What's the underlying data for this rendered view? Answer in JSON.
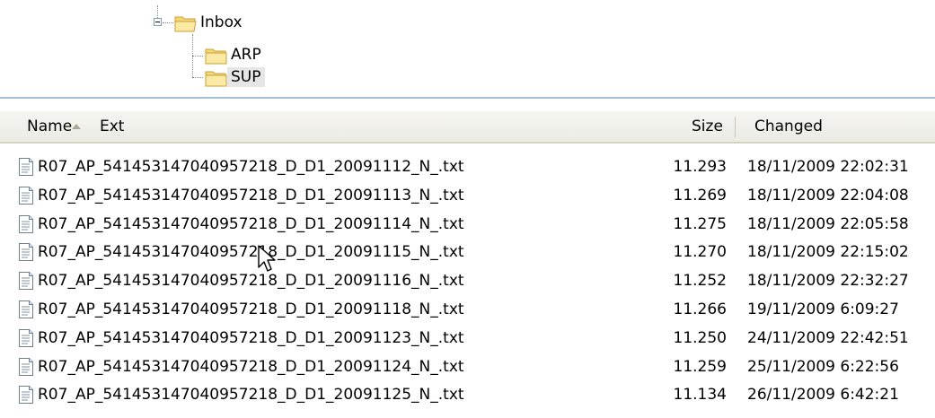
{
  "tree": {
    "items": [
      {
        "label": "Inbox",
        "icon": "open-folder-icon"
      },
      {
        "label": "ARP",
        "icon": "folder-icon"
      },
      {
        "label": "SUP",
        "icon": "folder-icon",
        "selected": true
      }
    ]
  },
  "list": {
    "columns": {
      "name": "Name",
      "ext": "Ext",
      "size": "Size",
      "changed": "Changed"
    },
    "sort": {
      "column": "name",
      "direction": "ascending"
    },
    "rows": [
      {
        "name": "R07_AP_541453147040957218_D_D1_20091112_N_.txt",
        "size": "11.293",
        "changed": "18/11/2009 22:02:31"
      },
      {
        "name": "R07_AP_541453147040957218_D_D1_20091113_N_.txt",
        "size": "11.269",
        "changed": "18/11/2009 22:04:08"
      },
      {
        "name": "R07_AP_541453147040957218_D_D1_20091114_N_.txt",
        "size": "11.275",
        "changed": "18/11/2009 22:05:58"
      },
      {
        "name": "R07_AP_541453147040957218_D_D1_20091115_N_.txt",
        "size": "11.270",
        "changed": "18/11/2009 22:15:02"
      },
      {
        "name": "R07_AP_541453147040957218_D_D1_20091116_N_.txt",
        "size": "11.252",
        "changed": "18/11/2009 22:32:27"
      },
      {
        "name": "R07_AP_541453147040957218_D_D1_20091118_N_.txt",
        "size": "11.266",
        "changed": "19/11/2009 6:09:27"
      },
      {
        "name": "R07_AP_541453147040957218_D_D1_20091123_N_.txt",
        "size": "11.250",
        "changed": "24/11/2009 22:42:51"
      },
      {
        "name": "R07_AP_541453147040957218_D_D1_20091124_N_.txt",
        "size": "11.259",
        "changed": "25/11/2009 6:22:56"
      },
      {
        "name": "R07_AP_541453147040957218_D_D1_20091125_N_.txt",
        "size": "11.134",
        "changed": "26/11/2009 6:42:21"
      }
    ]
  },
  "colors": {
    "folder_fill": "#f5d77a",
    "folder_stroke": "#c9a030",
    "header_bg": "#ebeae3",
    "selection_bg": "#e6e6e6"
  }
}
